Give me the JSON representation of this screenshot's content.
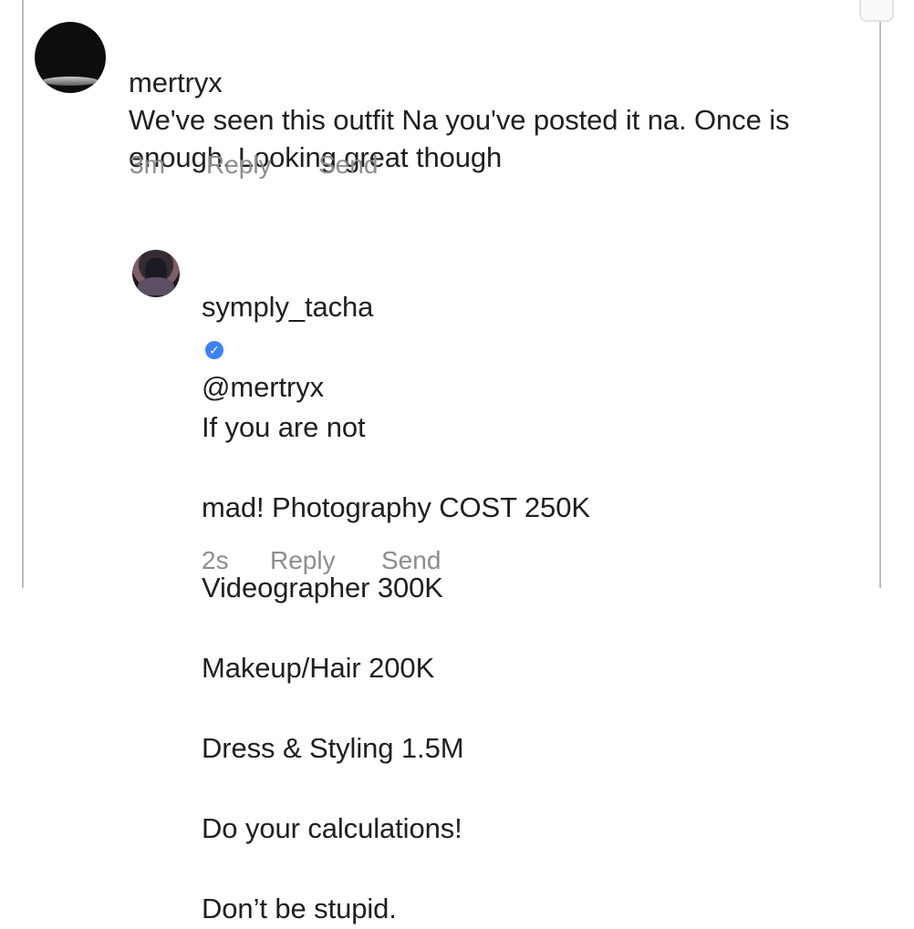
{
  "thread": {
    "comment": {
      "username": "mertryx",
      "text": "We've seen this outfit Na you've posted it na. Once is enough. Looking great though",
      "meta": {
        "time": "3m",
        "reply": "Reply",
        "send": "Send"
      }
    },
    "reply": {
      "username": "symply_tacha",
      "verified_icon": "verified-icon",
      "mention": "@mertryx",
      "text_lines": [
        "If you are not",
        "mad! Photography COST 250K",
        "Videographer 300K",
        "Makeup/Hair 200K",
        "Dress & Styling 1.5M",
        "Do your calculations!",
        "Don’t be stupid."
      ],
      "meta": {
        "time": "2s",
        "reply": "Reply",
        "send": "Send"
      }
    }
  }
}
